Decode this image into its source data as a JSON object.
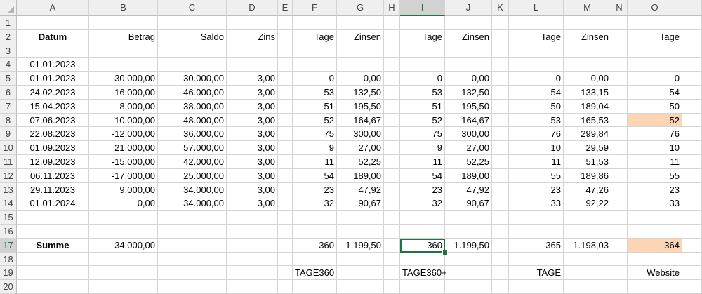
{
  "sheet": {
    "columns": [
      "A",
      "B",
      "C",
      "D",
      "E",
      "F",
      "G",
      "H",
      "I",
      "J",
      "K",
      "L",
      "M",
      "N",
      "O",
      ""
    ],
    "selected_cell": "I17",
    "fill_color": "#fcd5b4",
    "rows": [
      {
        "n": "1",
        "cells": {}
      },
      {
        "n": "2",
        "cells": {
          "A": "Datum",
          "B": "Betrag",
          "C": "Saldo",
          "D": "Zins",
          "F": "Tage",
          "G": "Zinsen",
          "I": "Tage",
          "J": "Zinsen",
          "L": "Tage",
          "M": "Zinsen",
          "O": "Tage"
        }
      },
      {
        "n": "3",
        "cells": {}
      },
      {
        "n": "4",
        "cells": {
          "A": "01.01.2023"
        }
      },
      {
        "n": "5",
        "cells": {
          "A": "01.01.2023",
          "B": "30.000,00",
          "C": "30.000,00",
          "D": "3,00",
          "F": "0",
          "G": "0,00",
          "I": "0",
          "J": "0,00",
          "L": "0",
          "M": "0,00",
          "O": "0"
        }
      },
      {
        "n": "6",
        "cells": {
          "A": "24.02.2023",
          "B": "16.000,00",
          "C": "46.000,00",
          "D": "3,00",
          "F": "53",
          "G": "132,50",
          "I": "53",
          "J": "132,50",
          "L": "54",
          "M": "133,15",
          "O": "54"
        }
      },
      {
        "n": "7",
        "cells": {
          "A": "15.04.2023",
          "B": "-8.000,00",
          "C": "38.000,00",
          "D": "3,00",
          "F": "51",
          "G": "195,50",
          "I": "51",
          "J": "195,50",
          "L": "50",
          "M": "189,04",
          "O": "50"
        }
      },
      {
        "n": "8",
        "cells": {
          "A": "07.06.2023",
          "B": "10.000,00",
          "C": "48.000,00",
          "D": "3,00",
          "F": "52",
          "G": "164,67",
          "I": "52",
          "J": "164,67",
          "L": "53",
          "M": "165,53",
          "O": "52"
        }
      },
      {
        "n": "9",
        "cells": {
          "A": "22.08.2023",
          "B": "-12.000,00",
          "C": "36.000,00",
          "D": "3,00",
          "F": "75",
          "G": "300,00",
          "I": "75",
          "J": "300,00",
          "L": "76",
          "M": "299,84",
          "O": "76"
        }
      },
      {
        "n": "10",
        "cells": {
          "A": "01.09.2023",
          "B": "21.000,00",
          "C": "57.000,00",
          "D": "3,00",
          "F": "9",
          "G": "27,00",
          "I": "9",
          "J": "27,00",
          "L": "10",
          "M": "29,59",
          "O": "10"
        }
      },
      {
        "n": "11",
        "cells": {
          "A": "12.09.2023",
          "B": "-15.000,00",
          "C": "42.000,00",
          "D": "3,00",
          "F": "11",
          "G": "52,25",
          "I": "11",
          "J": "52,25",
          "L": "11",
          "M": "51,53",
          "O": "11"
        }
      },
      {
        "n": "12",
        "cells": {
          "A": "06.11.2023",
          "B": "-17.000,00",
          "C": "25.000,00",
          "D": "3,00",
          "F": "54",
          "G": "189,00",
          "I": "54",
          "J": "189,00",
          "L": "55",
          "M": "189,86",
          "O": "55"
        }
      },
      {
        "n": "13",
        "cells": {
          "A": "29.11.2023",
          "B": "9.000,00",
          "C": "34.000,00",
          "D": "3,00",
          "F": "23",
          "G": "47,92",
          "I": "23",
          "J": "47,92",
          "L": "23",
          "M": "47,26",
          "O": "23"
        }
      },
      {
        "n": "14",
        "cells": {
          "A": "01.01.2024",
          "B": "0,00",
          "C": "34.000,00",
          "D": "3,00",
          "F": "32",
          "G": "90,67",
          "I": "32",
          "J": "90,67",
          "L": "33",
          "M": "92,22",
          "O": "33"
        }
      },
      {
        "n": "15",
        "cells": {}
      },
      {
        "n": "16",
        "cells": {}
      },
      {
        "n": "17",
        "cells": {
          "A": "Summe",
          "B": "34.000,00",
          "F": "360",
          "G": "1.199,50",
          "I": "360",
          "J": "1.199,50",
          "L": "365",
          "M": "1.198,03",
          "O": "364"
        }
      },
      {
        "n": "18",
        "cells": {}
      },
      {
        "n": "19",
        "cells": {
          "F": "TAGE360",
          "I": "TAGE360+",
          "L": "TAGE",
          "O": "Website"
        }
      },
      {
        "n": "20",
        "cells": {}
      }
    ]
  }
}
